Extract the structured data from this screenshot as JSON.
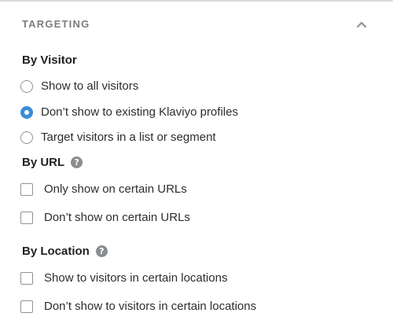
{
  "panel": {
    "title": "TARGETING",
    "collapse_icon": "chevron-up-icon"
  },
  "by_visitor": {
    "label": "By Visitor",
    "options": [
      {
        "label": "Show to all visitors",
        "selected": false
      },
      {
        "label": "Don’t show to existing Klaviyo profiles",
        "selected": true
      },
      {
        "label": "Target visitors in a list or segment",
        "selected": false
      }
    ]
  },
  "by_url": {
    "label": "By URL",
    "help_icon": "question-mark-icon",
    "options": [
      {
        "label": "Only show on certain URLs",
        "checked": false
      },
      {
        "label": "Don’t show on certain URLs",
        "checked": false
      }
    ]
  },
  "by_location": {
    "label": "By Location",
    "help_icon": "question-mark-icon",
    "options": [
      {
        "label": "Show to visitors in certain locations",
        "checked": false
      },
      {
        "label": "Don’t show to visitors in certain locations",
        "checked": false
      }
    ]
  },
  "colors": {
    "accent": "#3c8cd6",
    "muted": "#7a7e82"
  }
}
